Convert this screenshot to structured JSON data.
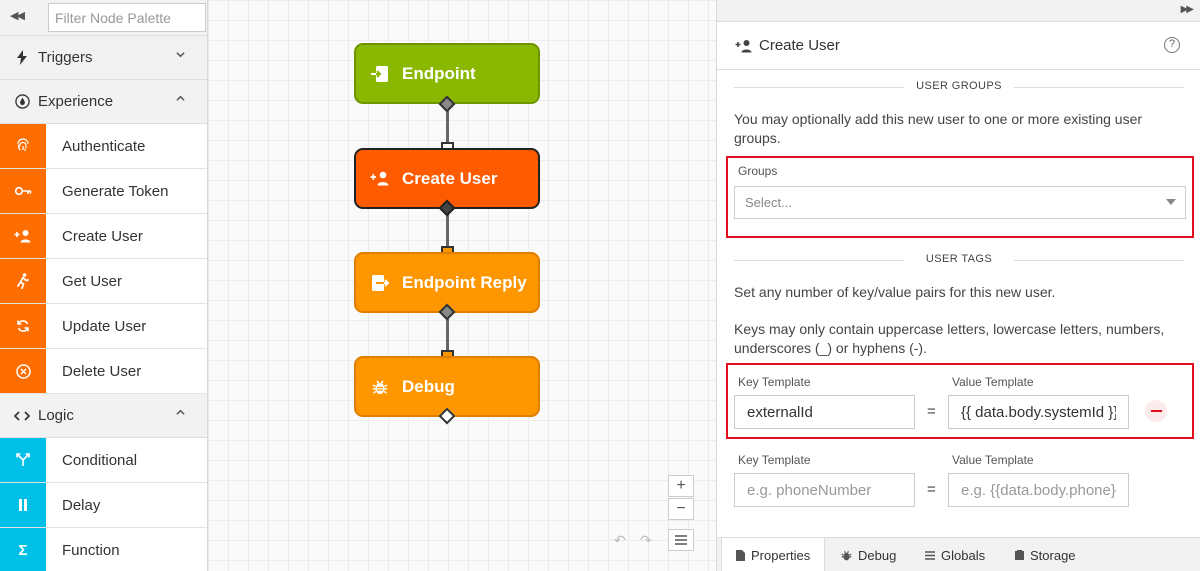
{
  "palette": {
    "filter_placeholder": "Filter Node Palette",
    "categories": [
      {
        "label": "Triggers",
        "icon": "bolt-icon",
        "expanded": false
      },
      {
        "label": "Experience",
        "icon": "droplet-icon",
        "expanded": true,
        "items": [
          {
            "label": "Authenticate",
            "icon": "fingerprint-icon"
          },
          {
            "label": "Generate Token",
            "icon": "key-icon"
          },
          {
            "label": "Create User",
            "icon": "user-plus-icon"
          },
          {
            "label": "Get User",
            "icon": "runner-icon"
          },
          {
            "label": "Update User",
            "icon": "refresh-icon"
          },
          {
            "label": "Delete User",
            "icon": "x-circle-icon"
          }
        ]
      },
      {
        "label": "Logic",
        "icon": "code-icon",
        "expanded": true,
        "items": [
          {
            "label": "Conditional",
            "icon": "branch-icon"
          },
          {
            "label": "Delay",
            "icon": "pause-icon"
          },
          {
            "label": "Function",
            "icon": "sigma-icon"
          }
        ]
      }
    ]
  },
  "canvas": {
    "nodes": [
      {
        "label": "Endpoint",
        "icon": "endpoint-icon",
        "color": "#8ab800"
      },
      {
        "label": "Create User",
        "icon": "user-plus-icon",
        "color": "#fe5a00",
        "selected": true
      },
      {
        "label": "Endpoint Reply",
        "icon": "endpoint-reply-icon",
        "color": "#fe9600"
      },
      {
        "label": "Debug",
        "icon": "bug-icon",
        "color": "#fe9600"
      }
    ],
    "zoom_in": "+",
    "zoom_out": "−"
  },
  "panel": {
    "title": "Create User",
    "help": "?",
    "user_groups": {
      "section_title": "USER GROUPS",
      "description": "You may optionally add this new user to one or more existing user groups.",
      "groups_label": "Groups",
      "groups_placeholder": "Select..."
    },
    "user_tags": {
      "section_title": "USER TAGS",
      "description1": "Set any number of key/value pairs for this new user.",
      "description2": "Keys may only contain uppercase letters, lowercase letters, numbers, underscores (_) or hyphens (-).",
      "rows": [
        {
          "key_label": "Key Template",
          "value_label": "Value Template",
          "key": "externalId",
          "value": "{{ data.body.systemId }}",
          "equals": "="
        },
        {
          "key_label": "Key Template",
          "value_label": "Value Template",
          "key_placeholder": "e.g. phoneNumber",
          "value_placeholder": "e.g. {{data.body.phone}}",
          "equals": "="
        }
      ]
    },
    "tabs": [
      {
        "label": "Properties",
        "icon": "file-icon",
        "active": true
      },
      {
        "label": "Debug",
        "icon": "bug-icon"
      },
      {
        "label": "Globals",
        "icon": "list-icon"
      },
      {
        "label": "Storage",
        "icon": "storage-icon"
      }
    ]
  },
  "colors": {
    "accent_orange": "#fe6d00",
    "accent_cyan": "#00c0e8",
    "highlight_red": "#e01020"
  }
}
